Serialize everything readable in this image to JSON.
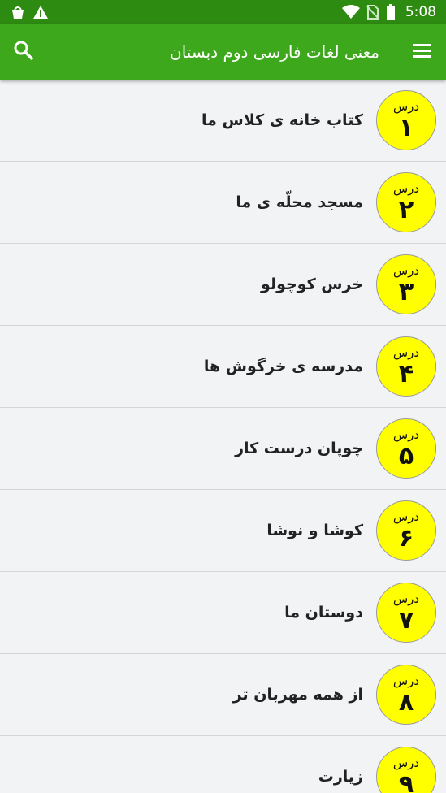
{
  "status_bar": {
    "time": "5:08",
    "left_icons": [
      "shopping-bag-icon",
      "warning-icon"
    ],
    "right_icons": [
      "wifi-icon",
      "no-sim-icon",
      "battery-icon"
    ]
  },
  "app_bar": {
    "title": "معنی لغات فارسی دوم دبستان",
    "menu_icon": "menu-icon",
    "search_icon": "search-icon"
  },
  "lessons": [
    {
      "badge_word": "درس",
      "number": "۱",
      "title": "کتاب خانه ی کلاس ما"
    },
    {
      "badge_word": "درس",
      "number": "۲",
      "title": "مسجد محلّه ی ما"
    },
    {
      "badge_word": "درس",
      "number": "۳",
      "title": "خرس کوچولو"
    },
    {
      "badge_word": "درس",
      "number": "۴",
      "title": "مدرسه ی خرگوش ها"
    },
    {
      "badge_word": "درس",
      "number": "۵",
      "title": "چوپان درست کار"
    },
    {
      "badge_word": "درس",
      "number": "۶",
      "title": "کوشا و نوشا"
    },
    {
      "badge_word": "درس",
      "number": "۷",
      "title": "دوستان ما"
    },
    {
      "badge_word": "درس",
      "number": "۸",
      "title": "از همه مهربان تر"
    },
    {
      "badge_word": "درس",
      "number": "۹",
      "title": "زیارت"
    }
  ],
  "colors": {
    "status_bar": "#2e8b12",
    "app_bar": "#3ea81c",
    "badge": "#ffff00",
    "background": "#f1f3f4"
  }
}
